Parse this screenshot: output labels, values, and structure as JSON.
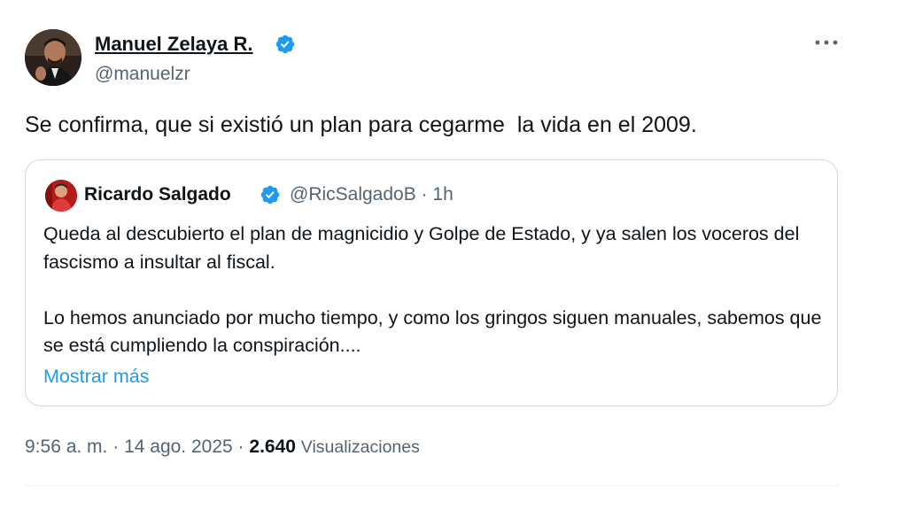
{
  "tweet": {
    "author": {
      "name": "Manuel Zelaya R.",
      "handle": "@manuelzr",
      "verified": true,
      "avatar_icon": "person-portrait-avatar"
    },
    "text": "Se confirma, que si existió un plan para cegarme  la vida en el 2009.",
    "more_icon": "ellipsis-icon",
    "quoted": {
      "author": {
        "name": "Ricardo Salgado",
        "handle": "@RicSalgadoB",
        "separator": "·",
        "time": "1h",
        "verified": true,
        "avatar_icon": "person-portrait-avatar"
      },
      "paragraphs": [
        "Queda al descubierto el plan de magnicidio y Golpe de Estado, y ya salen los voceros del fascismo a insultar al fiscal.",
        "Lo hemos anunciado por mucho tiempo, y como los gringos siguen manuales, sabemos que se está cumpliendo la conspiración...."
      ],
      "show_more": "Mostrar más"
    },
    "meta": {
      "time": "9:56 a. m.",
      "separator": "·",
      "date": "14 ago. 2025",
      "views_count": "2.640",
      "views_label": "Visualizaciones"
    }
  },
  "colors": {
    "text_primary": "#0f1419",
    "text_secondary": "#536471",
    "accent_blue": "#1d9bf0",
    "border": "#cfd9de"
  }
}
